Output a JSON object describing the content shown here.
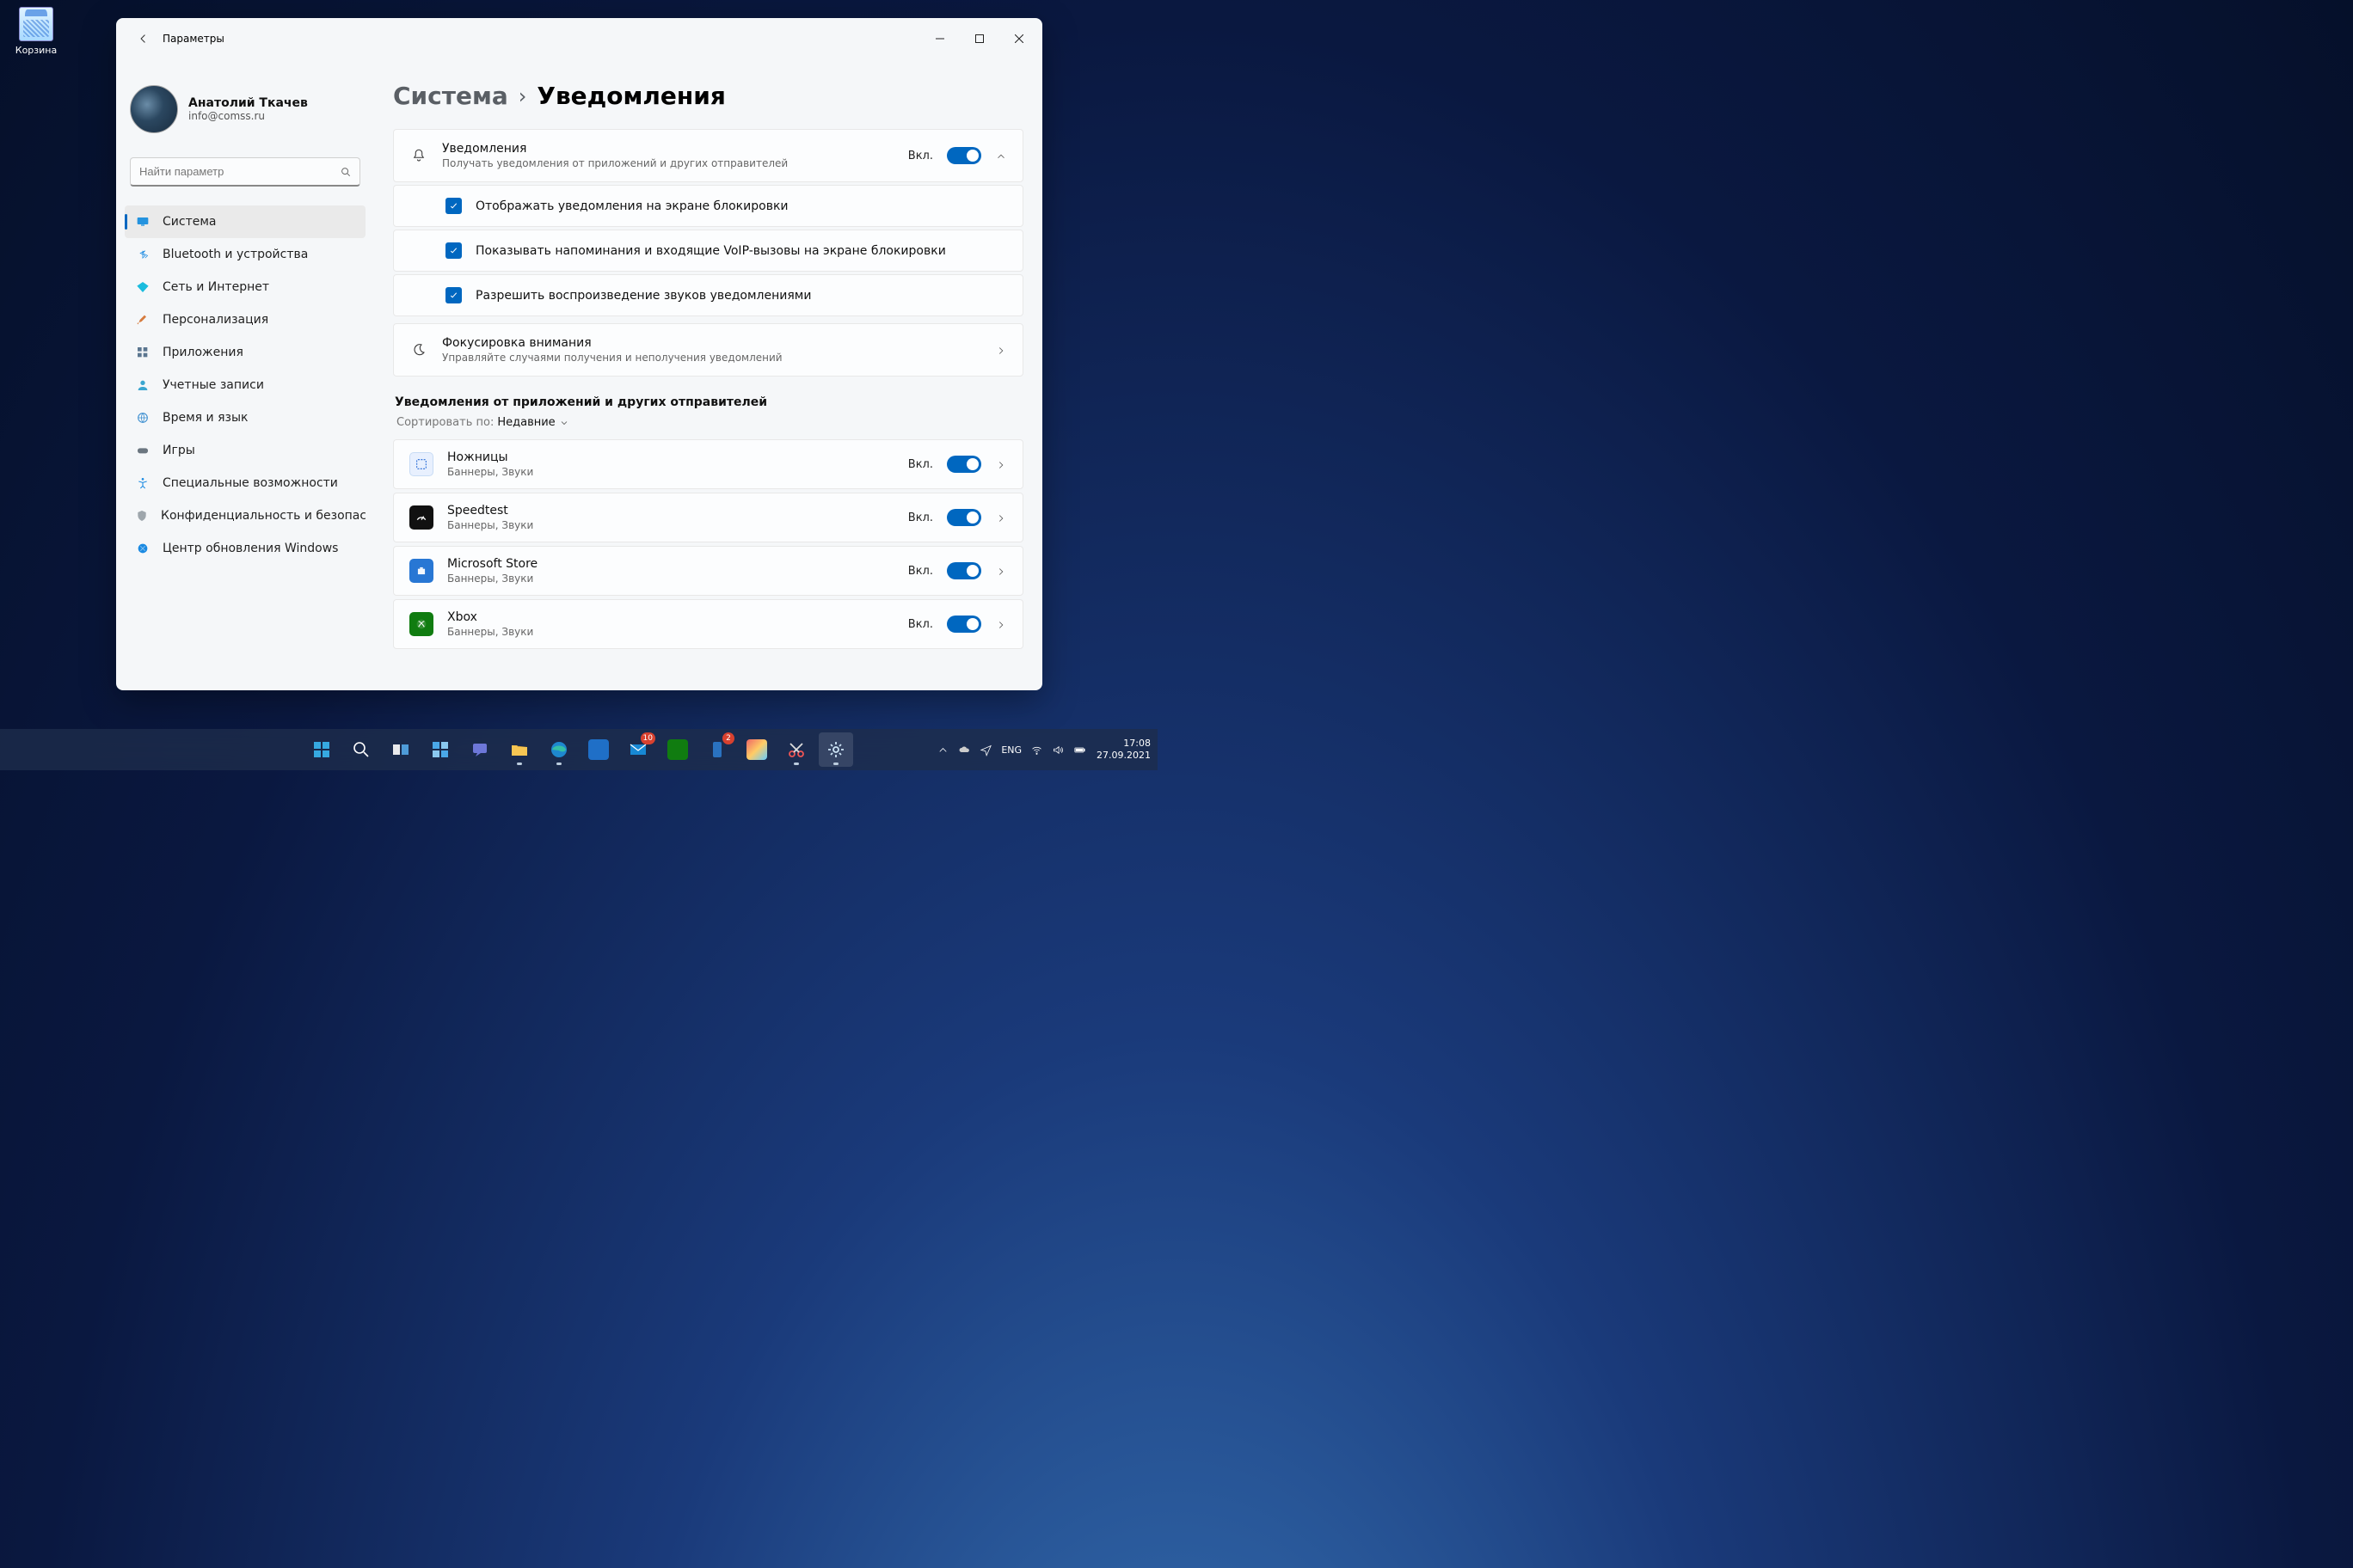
{
  "desktop": {
    "recycle_bin": "Корзина"
  },
  "titlebar": {
    "title": "Параметры"
  },
  "profile": {
    "name": "Анатолий Ткачев",
    "email": "info@comss.ru"
  },
  "search": {
    "placeholder": "Найти параметр"
  },
  "nav": {
    "items": [
      {
        "label": "Система"
      },
      {
        "label": "Bluetooth и устройства"
      },
      {
        "label": "Сеть и Интернет"
      },
      {
        "label": "Персонализация"
      },
      {
        "label": "Приложения"
      },
      {
        "label": "Учетные записи"
      },
      {
        "label": "Время и язык"
      },
      {
        "label": "Игры"
      },
      {
        "label": "Специальные возможности"
      },
      {
        "label": "Конфиденциальность и безопасность"
      },
      {
        "label": "Центр обновления Windows"
      }
    ]
  },
  "breadcrumb": {
    "parent": "Система",
    "current": "Уведомления"
  },
  "notif": {
    "title": "Уведомления",
    "sub": "Получать уведомления от приложений и других отправителей",
    "state": "Вкл.",
    "checks": [
      "Отображать уведомления на экране блокировки",
      "Показывать напоминания и входящие VoIP-вызовы на экране блокировки",
      "Разрешить  воспроизведение звуков уведомлениями"
    ]
  },
  "focus": {
    "title": "Фокусировка внимания",
    "sub": "Управляйте случаями получения и неполучения уведомлений"
  },
  "apps_section": {
    "title": "Уведомления от приложений и других отправителей",
    "sort_label": "Сортировать по:",
    "sort_value": "Недавние",
    "sub_text": "Баннеры, Звуки",
    "state": "Вкл.",
    "items": [
      {
        "name": "Ножницы",
        "color": "#2068d6",
        "bg": "#e8f0fe"
      },
      {
        "name": "Speedtest",
        "color": "#ffffff",
        "bg": "#111111"
      },
      {
        "name": "Microsoft Store",
        "color": "#ffffff",
        "bg": "#2877d4"
      },
      {
        "name": "Xbox",
        "color": "#ffffff",
        "bg": "#107c10"
      }
    ]
  },
  "taskbar": {
    "lang": "ENG",
    "time": "17:08",
    "date": "27.09.2021",
    "badges": {
      "mail": "10",
      "phone": "2"
    }
  }
}
